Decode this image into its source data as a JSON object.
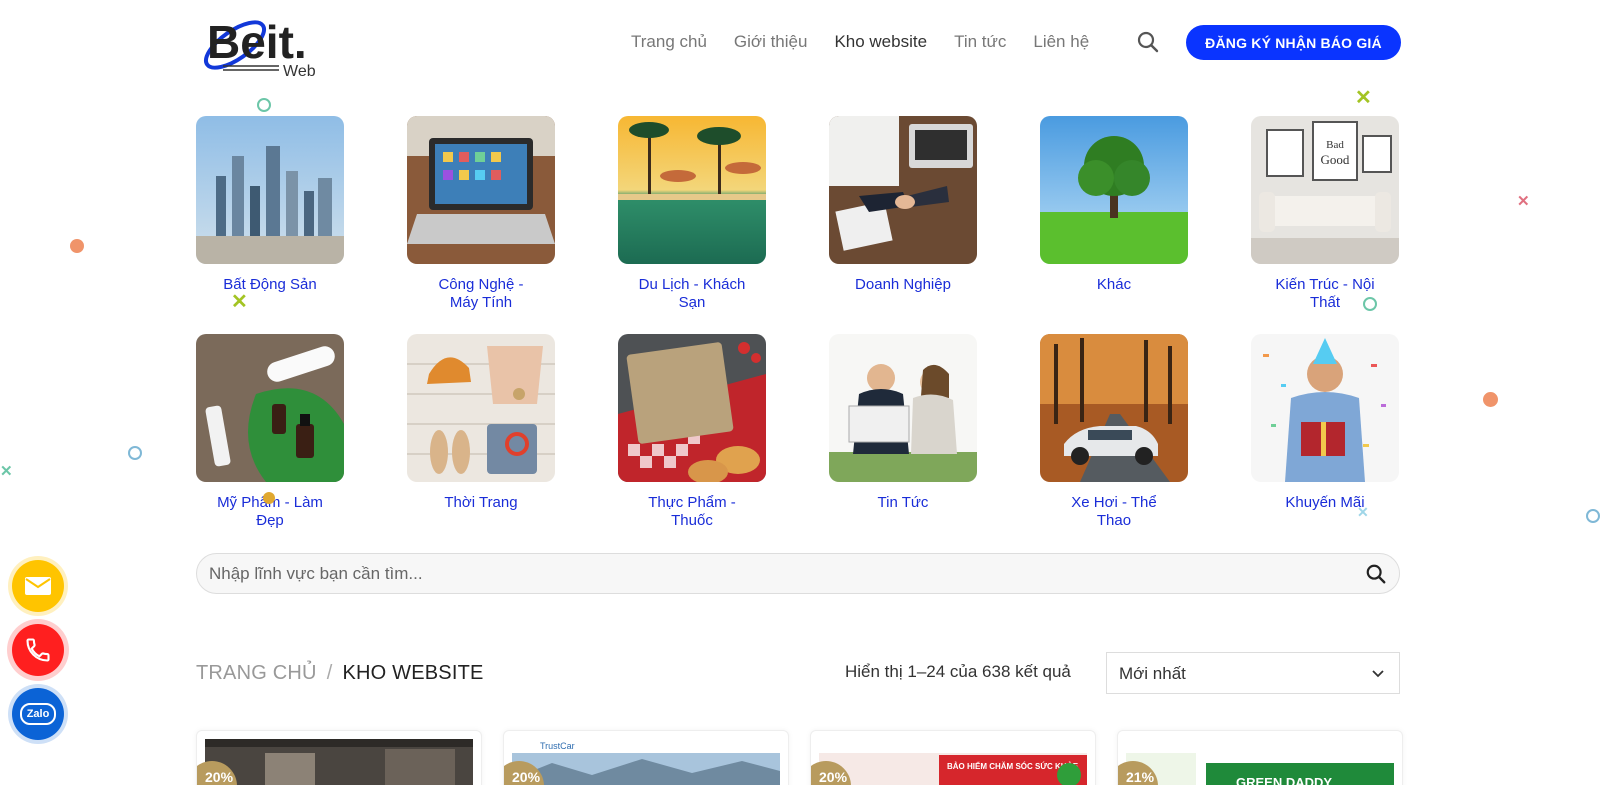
{
  "header": {
    "logo_text": "Beit.",
    "logo_sub": "Web",
    "nav": [
      {
        "label": "Trang chủ",
        "active": false
      },
      {
        "label": "Giới thiệu",
        "active": false
      },
      {
        "label": "Kho website",
        "active": true
      },
      {
        "label": "Tin tức",
        "active": false
      },
      {
        "label": "Liên hệ",
        "active": false
      }
    ],
    "search_icon": "search-icon",
    "cta_label": "ĐĂNG KÝ NHẬN BÁO GIÁ",
    "cta_color": "#0a34ff"
  },
  "categories": [
    {
      "label": "Bất Động Sản",
      "image": "city-skyline"
    },
    {
      "label": "Công Nghệ - Máy Tính",
      "image": "laptop"
    },
    {
      "label": "Du Lịch - Khách Sạn",
      "image": "resort-pool"
    },
    {
      "label": "Doanh Nghiệp",
      "image": "business-handshake"
    },
    {
      "label": "Khác",
      "image": "tree-field"
    },
    {
      "label": "Kiến Trúc - Nội Thất",
      "image": "living-room"
    },
    {
      "label": "Mỹ Phẩm - Làm Đẹp",
      "image": "cosmetics"
    },
    {
      "label": "Thời Trang",
      "image": "fashion-flatlay"
    },
    {
      "label": "Thực Phẩm - Thuốc",
      "image": "food-table"
    },
    {
      "label": "Tin Tức",
      "image": "reading-news"
    },
    {
      "label": "Xe Hơi - Thể Thao",
      "image": "car-road"
    },
    {
      "label": "Khuyến Mãi",
      "image": "gift-man"
    }
  ],
  "category_label_color": "#1a2dd8",
  "search": {
    "placeholder": "Nhập lĩnh vực bạn cần tìm...",
    "icon": "search-icon"
  },
  "breadcrumb": {
    "home": "TRANG CHỦ",
    "separator": "/",
    "current": "KHO WEBSITE"
  },
  "results": {
    "count_text": "Hiển thị 1–24 của 638 kết quả",
    "sort_selected": "Mới nhất"
  },
  "products": [
    {
      "thumb": "interior-site",
      "badge": "20%"
    },
    {
      "thumb": "trustcar-site",
      "header_text": "TrustCar",
      "badge": "20%"
    },
    {
      "thumb": "insurance-site",
      "banner_text": "BẢO HIỂM CHĂM SÓC SỨC KHỎE",
      "badge": "20%"
    },
    {
      "thumb": "green-site",
      "banner_text": "GREEN DADDY",
      "badge": "21%"
    }
  ],
  "contact_buttons": [
    {
      "name": "mail-icon",
      "color": "#ffc400"
    },
    {
      "name": "phone-icon",
      "color": "#ff1f1f"
    },
    {
      "name": "zalo-icon",
      "label": "Zalo",
      "color": "#0b63d6"
    }
  ]
}
